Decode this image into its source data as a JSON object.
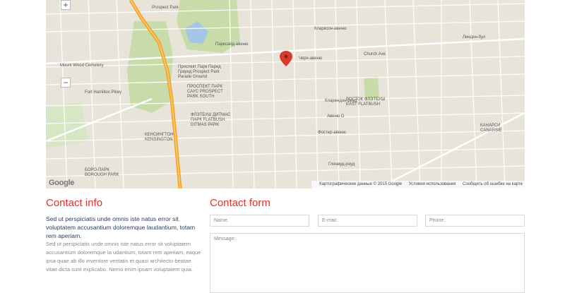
{
  "map": {
    "labels": {
      "prospect_park": "Prospect Park",
      "parade_ground": "Проспект Парк Паред Граунд Prospect Park Parade Ground",
      "prospect_park_south": "ПРОСПЕКТ ПАРК САУС PROSPECT PARK SOUTH",
      "flatbush": "ФЛЭТБУШ ДИТМАС ПАРК FLATBUSH DITMAS PARK",
      "kensington": "КЕНСИНГТОН KENSINGTON",
      "east_flatbush": "ВОСТОК ФЛЭТБУШ EAST FLATBUSH",
      "borough_park": "БОРО-ПАРК BOROUGH PARK",
      "canarsie": "КАНАРСИ CANARSIE",
      "greenwood": "Mount Wood Cemetery",
      "fort_hamilton": "Fort Hamilton Pkwy",
      "church_ave": "Church Ave",
      "church_ave_ru": "Черч-авеню",
      "clarendon": "Кларендон-роуд",
      "avenue_d": "Авеню D",
      "foster": "Фостер-авеню",
      "glenwood": "Гленвуд-роуд",
      "clarkson": "Кларксон-авеню",
      "linden": "Линден-бул",
      "parkside": "Парксайд-авеню",
      "route_27": "27"
    },
    "credit_data": "Картографические данные © 2015 Google",
    "credit_terms": "Условия использования",
    "credit_report": "Сообщить об ошибке на карте",
    "google_logo": "Google",
    "zoom_in": "+",
    "zoom_out": "−"
  },
  "contact_info": {
    "heading": "Contact info",
    "intro": "Sed ut perspiciatis unde omnis iste natus error sit voluptatem accusantium doloremque laudantium, totam rem aperiam.",
    "body": "Sed ut perspiciatis unde omnis iste natus error sit voluptatem accusantium doloremque la udantium, totam rem aperiam, eaque ipsa quae ab illo inventore veritatis et quasi architecto beatae vitae dicta sunt explicabo. Nemo enim ipsam voluptatem quia."
  },
  "contact_form": {
    "heading": "Contact form",
    "name_placeholder": "Name:",
    "email_placeholder": "E-mail:",
    "phone_placeholder": "Phone:",
    "message_placeholder": "Message:"
  },
  "colors": {
    "accent": "#e3302b",
    "map_bg": "#e8e4da",
    "park_green": "#c8dcaa",
    "water": "#a4c5e6",
    "highway": "#f4a324"
  }
}
